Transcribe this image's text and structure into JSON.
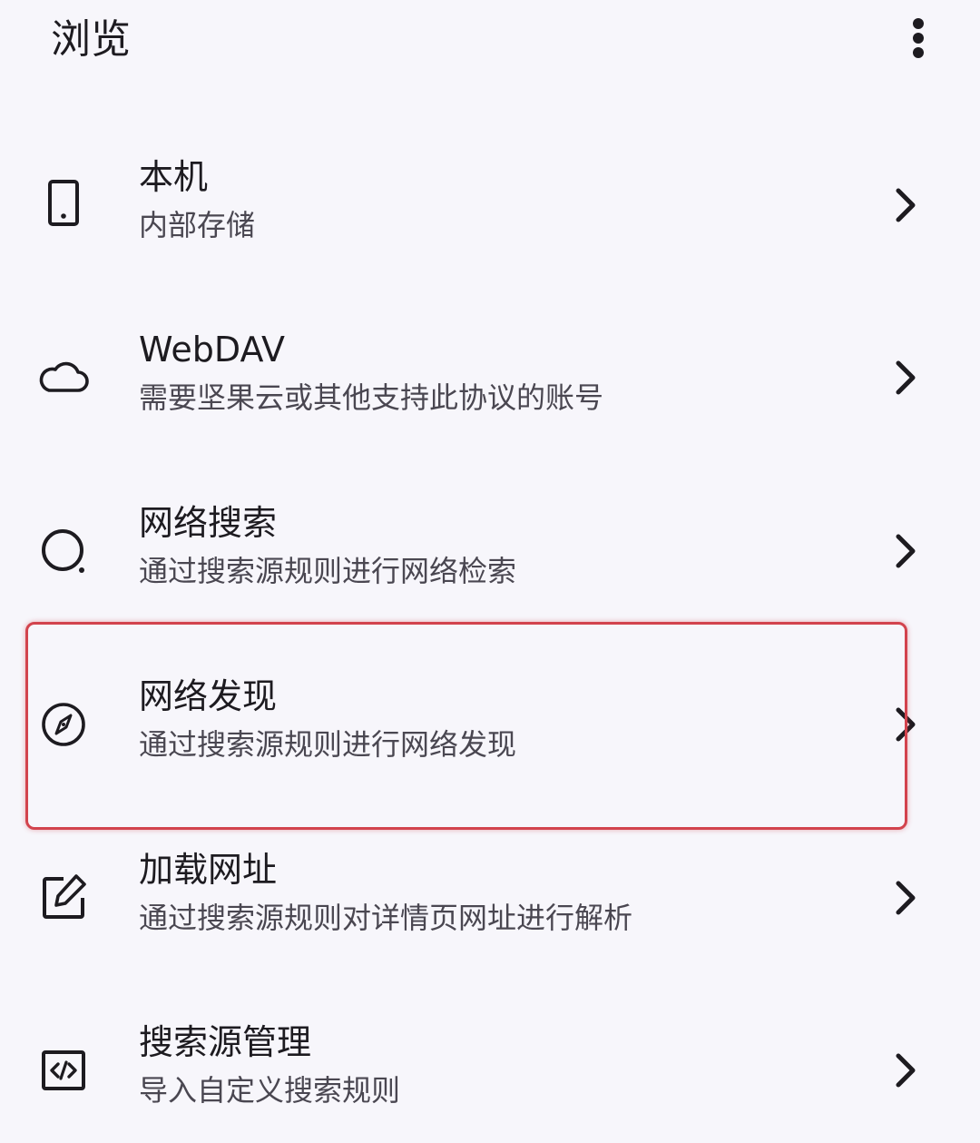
{
  "app_bar": {
    "title": "浏览",
    "overflow_icon": "more-vert-icon"
  },
  "items": [
    {
      "title": "本机",
      "subtitle": "内部存储",
      "icon": "phone-icon"
    },
    {
      "title": "WebDAV",
      "subtitle": "需要坚果云或其他支持此协议的账号",
      "icon": "cloud-icon"
    },
    {
      "title": "网络搜索",
      "subtitle": "通过搜索源规则进行网络检索",
      "icon": "search-icon"
    },
    {
      "title": "网络发现",
      "subtitle": "通过搜索源规则进行网络发现",
      "icon": "compass-icon"
    },
    {
      "title": "加载网址",
      "subtitle": "通过搜索源规则对详情页网址进行解析",
      "icon": "edit-icon"
    },
    {
      "title": "搜索源管理",
      "subtitle": "导入自定义搜索规则",
      "icon": "code-icon"
    }
  ],
  "highlight": {
    "target": "网络发现",
    "color": "#d2434d"
  },
  "colors": {
    "background": "#f7f6fb",
    "text_primary": "#1d1b20",
    "text_secondary": "#4a4751"
  }
}
